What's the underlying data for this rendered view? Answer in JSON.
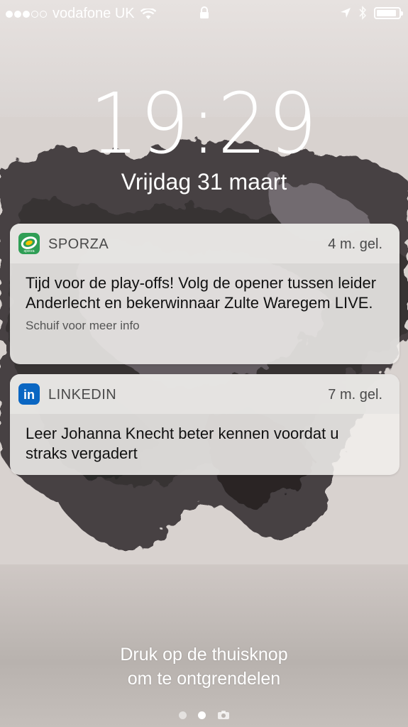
{
  "status_bar": {
    "signal_bars_filled": 3,
    "signal_bars_total": 5,
    "carrier": "vodafone UK",
    "battery_level": 0.9
  },
  "lockscreen": {
    "time": "19:29",
    "date": "Vrijdag 31 maart",
    "unlock_hint_line1": "Druk op de thuisknop",
    "unlock_hint_line2": "om te ontgrendelen"
  },
  "notifications": [
    {
      "app": "SPORZA",
      "age": "4 m. gel.",
      "message": "Tijd voor de play-offs! Volg de opener tussen leider Anderlecht en bekerwinnaar Zulte Waregem LIVE.",
      "more": "Schuif voor meer info",
      "icon": "sporza-icon",
      "icon_label": "sporza"
    },
    {
      "app": "LINKEDIN",
      "age": "7 m. gel.",
      "message": "Leer Johanna Knecht beter kennen voordat u straks vergadert",
      "icon": "linkedin-icon",
      "icon_label": "in"
    }
  ],
  "colors": {
    "sporza_green": "#2f9e55",
    "linkedin_blue": "#0a66c2"
  },
  "pager": {
    "pages": 2,
    "active": 1,
    "camera_icon": "camera-icon"
  }
}
